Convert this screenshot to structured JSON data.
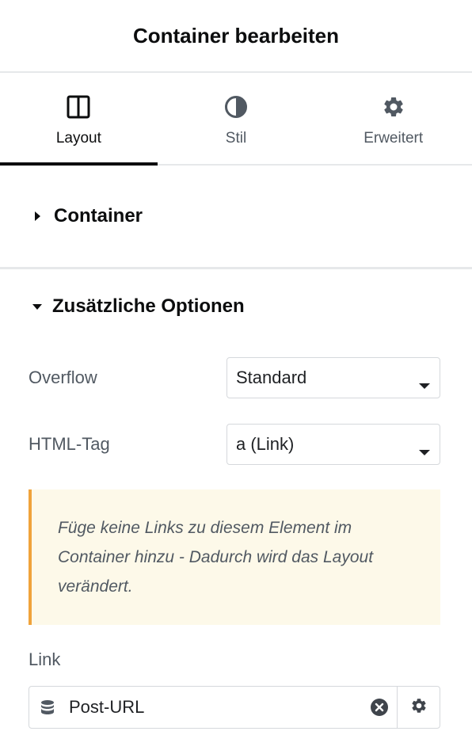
{
  "header": {
    "title": "Container bearbeiten"
  },
  "tabs": [
    {
      "label": "Layout",
      "icon": "columns-icon",
      "active": true
    },
    {
      "label": "Stil",
      "icon": "contrast-icon",
      "active": false
    },
    {
      "label": "Erweitert",
      "icon": "gear-icon",
      "active": false
    }
  ],
  "sections": {
    "container": {
      "title": "Container",
      "expanded": false
    },
    "extra": {
      "title": "Zusätzliche Optionen",
      "expanded": true
    }
  },
  "controls": {
    "overflow": {
      "label": "Overflow",
      "value": "Standard"
    },
    "html_tag": {
      "label": "HTML-Tag",
      "value": "a (Link)"
    }
  },
  "notice": {
    "text": "Füge keine Links zu diesem Element im Container hinzu - Dadurch wird das Layout verändert."
  },
  "link": {
    "label": "Link",
    "value": "Post-URL",
    "icon": "database-icon"
  },
  "colors": {
    "accent": "#0c0d0e",
    "notice_border": "#f0a33b",
    "notice_bg": "#fdf9e9"
  }
}
